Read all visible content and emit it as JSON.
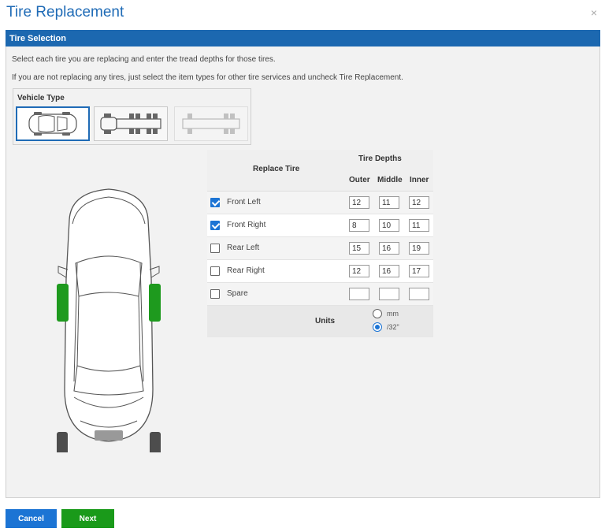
{
  "dialog": {
    "title": "Tire Replacement",
    "close": "×"
  },
  "section": {
    "header": "Tire Selection"
  },
  "instructions": {
    "line1": "Select each tire you are replacing and enter the tread depths for those tires.",
    "line2": "If you are not replacing any tires, just select the item types for other tire services and uncheck Tire Replacement."
  },
  "vehicle_type": {
    "label": "Vehicle Type",
    "options": [
      {
        "icon": "car-icon",
        "selected": true
      },
      {
        "icon": "truck-icon",
        "selected": false
      },
      {
        "icon": "trailer-icon",
        "selected": false,
        "disabled": true
      }
    ]
  },
  "table": {
    "header_replace": "Replace Tire",
    "header_depths": "Tire Depths",
    "col_outer": "Outer",
    "col_middle": "Middle",
    "col_inner": "Inner",
    "rows": [
      {
        "name": "Front Left",
        "checked": true,
        "outer": "12",
        "middle": "11",
        "inner": "12"
      },
      {
        "name": "Front Right",
        "checked": true,
        "outer": "8",
        "middle": "10",
        "inner": "11"
      },
      {
        "name": "Rear Left",
        "checked": false,
        "outer": "15",
        "middle": "16",
        "inner": "19"
      },
      {
        "name": "Rear Right",
        "checked": false,
        "outer": "12",
        "middle": "16",
        "inner": "17"
      },
      {
        "name": "Spare",
        "checked": false,
        "outer": "",
        "middle": "",
        "inner": ""
      }
    ],
    "units_label": "Units",
    "unit_mm": "mm",
    "unit_32": "/32\"",
    "selected_unit": "/32\""
  },
  "colors": {
    "accent": "#1c68b0",
    "tire_selected": "#1e9a1e",
    "tire_unselected": "#4d4d4d",
    "next_button": "#1a9a1a"
  },
  "buttons": {
    "cancel": "Cancel",
    "next": "Next"
  }
}
